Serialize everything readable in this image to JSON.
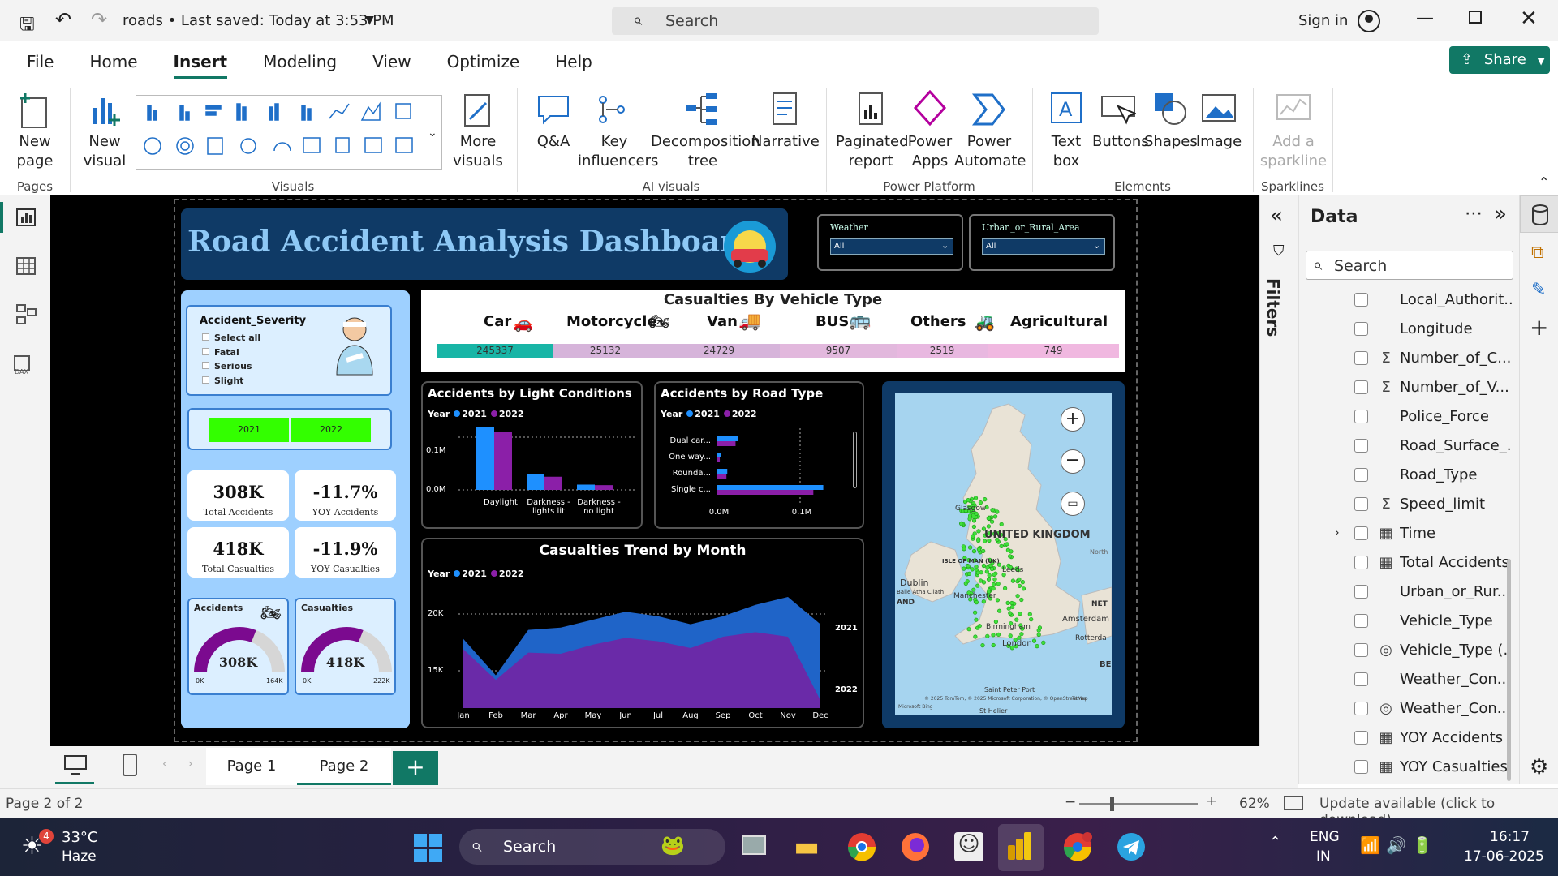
{
  "app": {
    "title": "roads • Last saved: Today at 3:53 PM",
    "search_placeholder": "Search",
    "sign_in": "Sign in"
  },
  "ribbon": {
    "tabs": [
      "File",
      "Home",
      "Insert",
      "Modeling",
      "View",
      "Optimize",
      "Help"
    ],
    "share": "Share",
    "buttons": {
      "new_page": "New page",
      "new_visual": "New visual",
      "more_visuals": "More visuals",
      "qa": "Q&A",
      "key_influencers": "Key influencers",
      "decomposition_tree": "Decomposition tree",
      "narrative": "Narrative",
      "paginated_report": "Paginated report",
      "power_apps": "Power Apps",
      "power_automate": "Power Automate",
      "text_box": "Text box",
      "buttons": "Buttons",
      "shapes": "Shapes",
      "image": "Image",
      "add_sparkline": "Add a sparkline"
    },
    "groups": {
      "pages": "Pages",
      "visuals": "Visuals",
      "ai_visuals": "AI visuals",
      "power_platform": "Power Platform",
      "elements": "Elements",
      "sparklines": "Sparklines"
    }
  },
  "report": {
    "title": "Road Accident Analysis Dashboard",
    "slicers": [
      {
        "label": "Weather",
        "value": "All"
      },
      {
        "label": "Urban_or_Rural_Area",
        "value": "All"
      }
    ],
    "severity": {
      "title": "Accident_Severity",
      "options": [
        "Select all",
        "Fatal",
        "Serious",
        "Slight"
      ]
    },
    "years": [
      "2021",
      "2022"
    ],
    "kpis": [
      {
        "value": "308K",
        "label": "Total Accidents"
      },
      {
        "value": "-11.7%",
        "label": "YOY Accidents"
      },
      {
        "value": "418K",
        "label": "Total Casualties"
      },
      {
        "value": "-11.9%",
        "label": "YOY Casualties"
      }
    ],
    "gauges": [
      {
        "title": "Accidents",
        "value": "308K",
        "min": "0K",
        "max": "164K",
        "fill": 0.62
      },
      {
        "title": "Casualties",
        "value": "418K",
        "min": "0K",
        "max": "222K",
        "fill": 0.62
      }
    ],
    "vehicle": {
      "title": "Casualties By Vehicle Type",
      "types": [
        "Car",
        "Motorcycle",
        "Van",
        "BUS",
        "Others",
        "Agricultural"
      ],
      "values": [
        "245337",
        "25132",
        "24729",
        "9507",
        "2519",
        "749"
      ]
    },
    "light": {
      "title": "Accidents by Light Conditions",
      "legend_title": "Year",
      "legend": [
        "2021",
        "2022"
      ],
      "y_ticks": [
        "0.1M",
        "0.0M"
      ],
      "categories": [
        "Daylight",
        "Darkness - lights lit",
        "Darkness - no light"
      ]
    },
    "road": {
      "title": "Accidents by Road Type",
      "legend_title": "Year",
      "legend": [
        "2021",
        "2022"
      ],
      "categories": [
        "Dual car...",
        "One way...",
        "Rounda...",
        "Single c..."
      ],
      "x_ticks": [
        "0.0M",
        "0.1M"
      ]
    },
    "trend": {
      "title": "Casualties Trend by Month",
      "legend_title": "Year",
      "legend": [
        "2021",
        "2022"
      ],
      "y_ticks": [
        "20K",
        "15K"
      ],
      "months": [
        "Jan",
        "Feb",
        "Mar",
        "Apr",
        "May",
        "Jun",
        "Jul",
        "Aug",
        "Sep",
        "Oct",
        "Nov",
        "Dec"
      ],
      "series_labels": [
        "2021",
        "2022"
      ]
    },
    "map": {
      "country": "UNITED KINGDOM",
      "labels": [
        "Glasgow",
        "ISLE OF MAN (UK)",
        "Dublin",
        "Manchester",
        "Leeds",
        "Birmingham",
        "London",
        "Amsterdam",
        "Rotterda",
        "Saint Peter Port",
        "St Helier",
        "North",
        "NET",
        "BE",
        "AND",
        "Baile Átha Cliath"
      ],
      "credit": "© 2025 TomTom, © 2025 Microsoft Corporation, © OpenStreetMap",
      "terms": "Terms",
      "bing": "Microsoft Bing"
    }
  },
  "chart_data": [
    {
      "type": "bar",
      "title": "Casualties By Vehicle Type",
      "categories": [
        "Car",
        "Motorcycle",
        "Van",
        "BUS",
        "Others",
        "Agricultural"
      ],
      "values": [
        245337,
        25132,
        24729,
        9507,
        2519,
        749
      ]
    },
    {
      "type": "bar",
      "title": "Accidents by Light Conditions",
      "xlabel": "",
      "ylabel": "",
      "categories": [
        "Daylight",
        "Darkness - lights lit",
        "Darkness - no light"
      ],
      "series": [
        {
          "name": "2021",
          "values": [
            0.12,
            0.03,
            0.01
          ]
        },
        {
          "name": "2022",
          "values": [
            0.11,
            0.025,
            0.009
          ]
        }
      ],
      "ylim": [
        0,
        0.12
      ]
    },
    {
      "type": "bar",
      "title": "Accidents by Road Type",
      "categories": [
        "Dual car...",
        "One way...",
        "Rounda...",
        "Single c..."
      ],
      "series": [
        {
          "name": "2021",
          "values": [
            0.025,
            0.004,
            0.012,
            0.128
          ]
        },
        {
          "name": "2022",
          "values": [
            0.022,
            0.003,
            0.011,
            0.116
          ]
        }
      ],
      "xlim": [
        0,
        0.13
      ]
    },
    {
      "type": "area",
      "title": "Casualties Trend by Month",
      "categories": [
        "Jan",
        "Feb",
        "Mar",
        "Apr",
        "May",
        "Jun",
        "Jul",
        "Aug",
        "Sep",
        "Oct",
        "Nov",
        "Dec"
      ],
      "series": [
        {
          "name": "2021",
          "values": [
            17800,
            14600,
            18600,
            18800,
            19500,
            20200,
            19800,
            19100,
            19800,
            20800,
            21500,
            19100
          ]
        },
        {
          "name": "2022",
          "values": [
            16900,
            14200,
            16600,
            16500,
            17300,
            17900,
            17600,
            17000,
            18000,
            18400,
            18000,
            12400
          ]
        }
      ],
      "ylim": [
        12000,
        22000
      ]
    }
  ],
  "filters_label": "Filters",
  "data_pane": {
    "title": "Data",
    "search_placeholder": "Search",
    "fields": [
      {
        "icon": "",
        "label": "Local_Authorit..."
      },
      {
        "icon": "",
        "label": "Longitude"
      },
      {
        "icon": "Σ",
        "label": "Number_of_C..."
      },
      {
        "icon": "Σ",
        "label": "Number_of_V..."
      },
      {
        "icon": "",
        "label": "Police_Force"
      },
      {
        "icon": "",
        "label": "Road_Surface_..."
      },
      {
        "icon": "",
        "label": "Road_Type"
      },
      {
        "icon": "Σ",
        "label": "Speed_limit"
      },
      {
        "icon": "▦",
        "label": "Time"
      },
      {
        "icon": "▦",
        "label": "Total Accidents"
      },
      {
        "icon": "",
        "label": "Urban_or_Rur..."
      },
      {
        "icon": "",
        "label": "Vehicle_Type"
      },
      {
        "icon": "◎",
        "label": "Vehicle_Type (..."
      },
      {
        "icon": "",
        "label": "Weather_Con..."
      },
      {
        "icon": "◎",
        "label": "Weather_Con..."
      },
      {
        "icon": "▦",
        "label": "YOY Accidents"
      },
      {
        "icon": "▦",
        "label": "YOY Casualties"
      }
    ]
  },
  "pages": [
    "Page 1",
    "Page 2"
  ],
  "status": {
    "page": "Page 2 of 2",
    "zoom": "62%",
    "update": "Update available (click to download)"
  },
  "taskbar": {
    "temp": "33°C",
    "weather": "Haze",
    "badge": "4",
    "search": "Search",
    "lang1": "ENG",
    "lang2": "IN",
    "time": "16:17",
    "date": "17-06-2025"
  },
  "colors": {
    "accent": "#117865",
    "y2021": "#1e90ff",
    "y2022": "#8b1fa8",
    "slicer_green": "#33ff00",
    "panel_blue": "#9ed0ff",
    "title_blue": "#0f3a66"
  }
}
